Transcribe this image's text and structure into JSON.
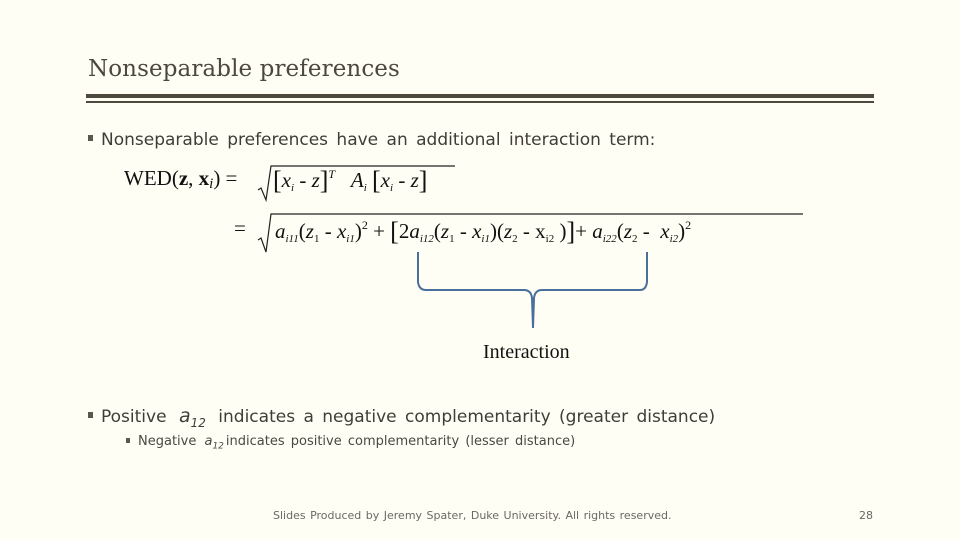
{
  "slide": {
    "title": "Nonseparable preferences",
    "bullet1": "Nonseparable preferences have an additional interaction term:",
    "equation1": {
      "lhs_name": "WED(",
      "lhs_z": "z",
      "lhs_sep": ", ",
      "lhs_x": "x",
      "lhs_i": "i",
      "lhs_close": ") =",
      "radicand": "[x_i - z]^T A_i [x_i - z]"
    },
    "equation2": {
      "equals": "=",
      "radicand": "a_i11 (z_1 - x_i1)^2 + [2a_i12 (z_1 - x_i1)(z_2 - x_i2)] + a_i22 (z_2 - x_i2)^2"
    },
    "brace_label": "Interaction",
    "bullet2": {
      "pre": "Positive",
      "sym": "a",
      "sub": "12",
      "post": "indicates a negative complementarity (greater distance)"
    },
    "bullet3": {
      "pre": "Negative",
      "sym": "a",
      "sub": "12",
      "post": "indicates positive complementarity (lesser distance)"
    },
    "footer": "Slides Produced by Jeremy Spater, Duke University.  All rights reserved.",
    "page_number": "28"
  },
  "colors": {
    "background": "#fffef4",
    "title_rule": "#4d493c",
    "brace": "#4a6f9c"
  }
}
